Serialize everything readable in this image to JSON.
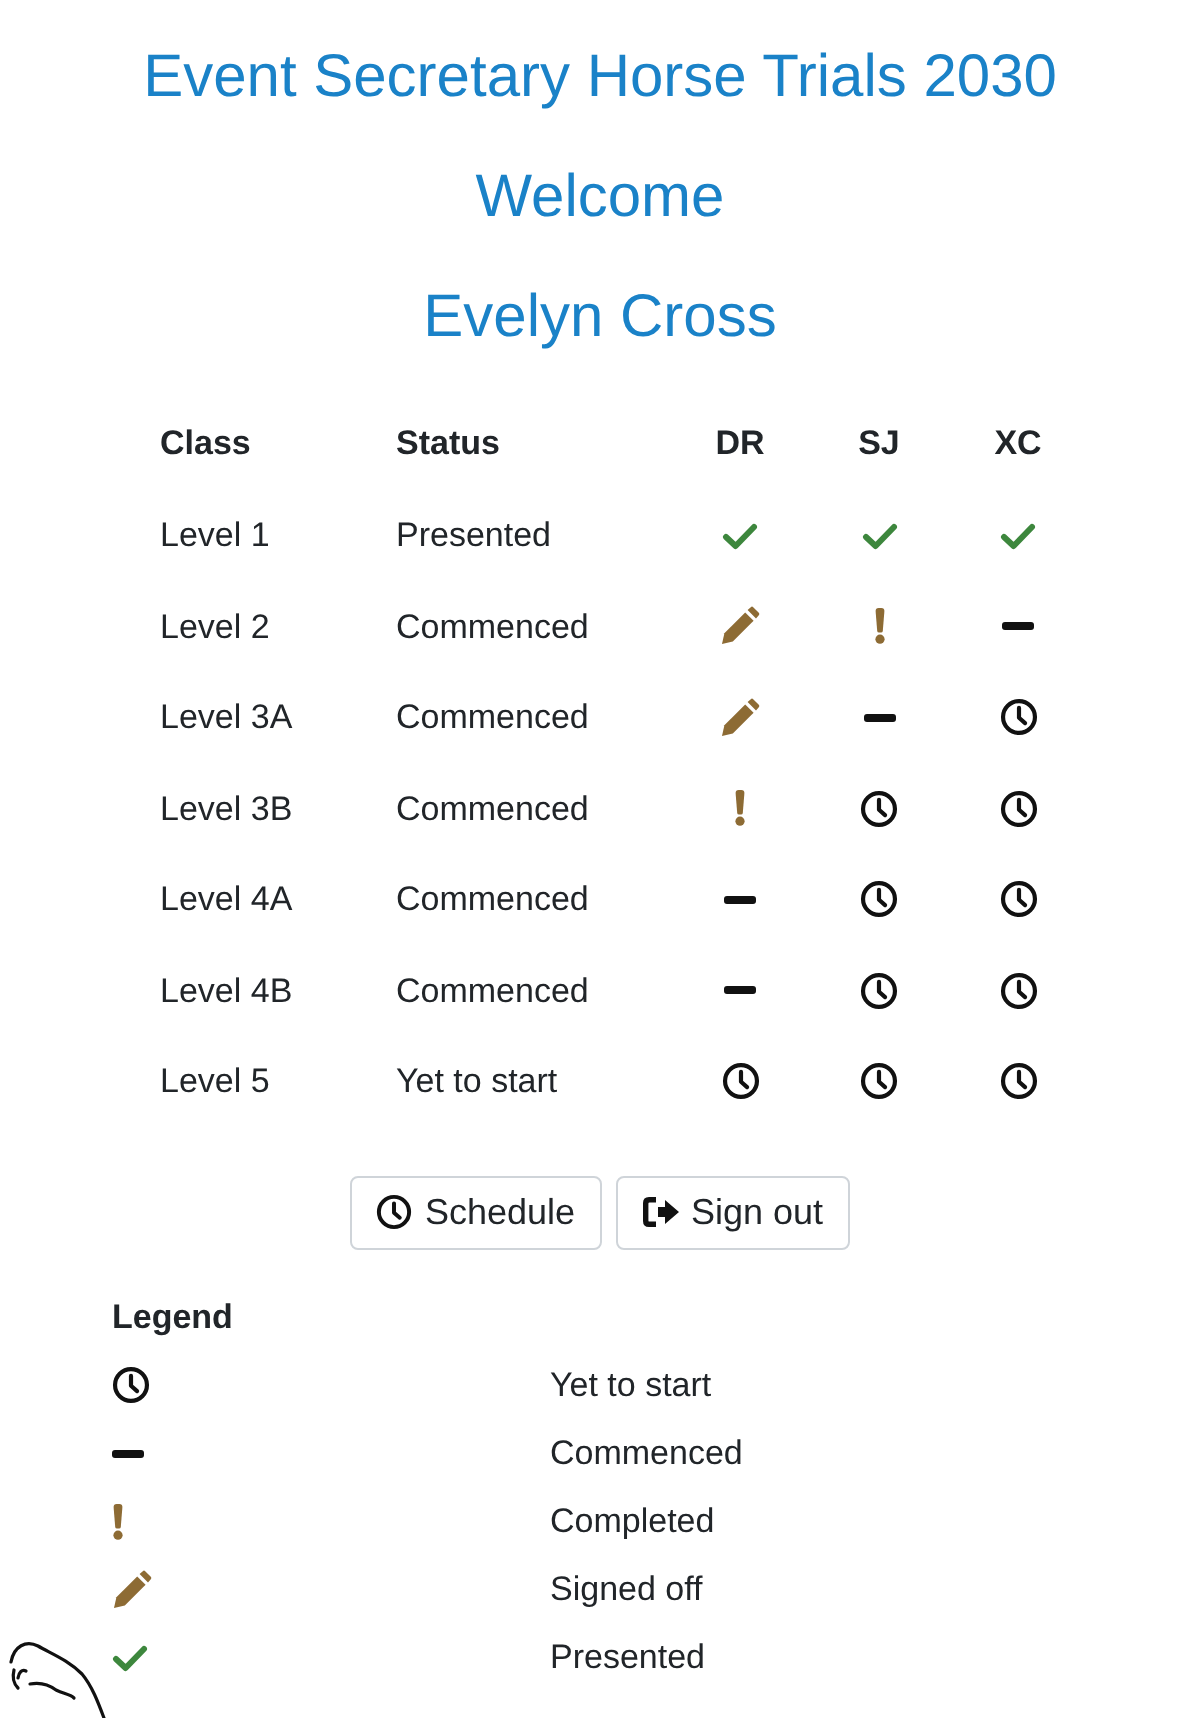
{
  "header": {
    "event_title": "Event Secretary Horse Trials 2030",
    "greeting": "Welcome",
    "user_name": "Evelyn Cross"
  },
  "table": {
    "columns": [
      "Class",
      "Status",
      "DR",
      "SJ",
      "XC"
    ],
    "rows": [
      {
        "class": "Level 1",
        "status": "Presented",
        "phases": [
          {
            "kind": "check"
          },
          {
            "kind": "check"
          },
          {
            "kind": "check"
          }
        ]
      },
      {
        "class": "Level 2",
        "status": "Commenced",
        "phases": [
          {
            "kind": "pencil"
          },
          {
            "kind": "exclaim"
          },
          {
            "kind": "dash"
          }
        ]
      },
      {
        "class": "Level 3A",
        "status": "Commenced",
        "phases": [
          {
            "kind": "pencil"
          },
          {
            "kind": "dash"
          },
          {
            "kind": "clock"
          }
        ]
      },
      {
        "class": "Level 3B",
        "status": "Commenced",
        "phases": [
          {
            "kind": "exclaim"
          },
          {
            "kind": "clock"
          },
          {
            "kind": "clock"
          }
        ]
      },
      {
        "class": "Level 4A",
        "status": "Commenced",
        "phases": [
          {
            "kind": "dash"
          },
          {
            "kind": "clock"
          },
          {
            "kind": "clock"
          }
        ]
      },
      {
        "class": "Level 4B",
        "status": "Commenced",
        "phases": [
          {
            "kind": "dash"
          },
          {
            "kind": "clock"
          },
          {
            "kind": "clock"
          }
        ]
      },
      {
        "class": "Level 5",
        "status": "Yet to start",
        "phases": [
          {
            "kind": "clock"
          },
          {
            "kind": "clock"
          },
          {
            "kind": "clock"
          }
        ]
      }
    ]
  },
  "buttons": [
    {
      "kind": "schedule",
      "label": "Schedule"
    },
    {
      "kind": "sign_out",
      "label": "Sign out"
    }
  ],
  "legend": {
    "title": "Legend",
    "items": [
      {
        "kind": "clock",
        "label": "Yet to start"
      },
      {
        "kind": "dash",
        "label": "Commenced"
      },
      {
        "kind": "exclaim",
        "label": "Completed"
      },
      {
        "kind": "pencil",
        "label": "Signed off"
      },
      {
        "kind": "check",
        "label": "Presented"
      }
    ]
  }
}
